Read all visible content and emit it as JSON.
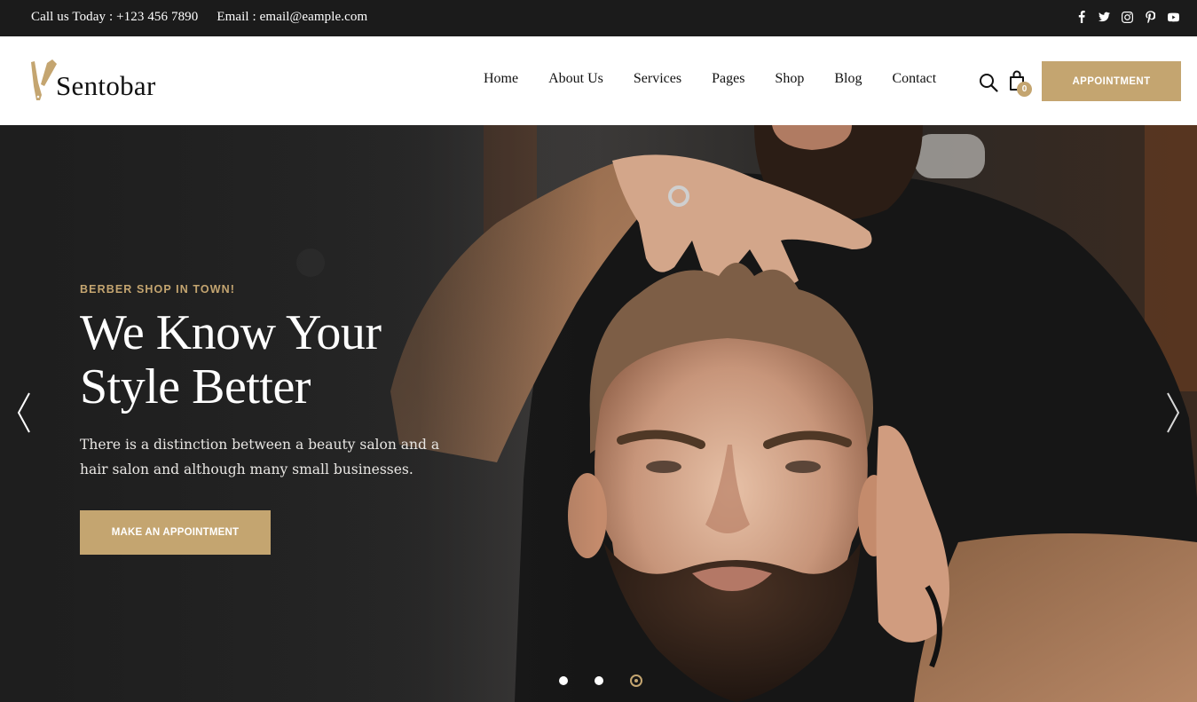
{
  "topbar": {
    "phone": "Call us Today : +123 456 7890",
    "email": "Email : email@eample.com",
    "social": [
      {
        "icon": "facebook-icon"
      },
      {
        "icon": "twitter-icon"
      },
      {
        "icon": "instagram-icon"
      },
      {
        "icon": "pinterest-icon"
      },
      {
        "icon": "youtube-icon"
      }
    ]
  },
  "header": {
    "brand": "Sentobar",
    "nav": [
      "Home",
      "About Us",
      "Services",
      "Pages",
      "Shop",
      "Blog",
      "Contact"
    ],
    "cart_count": "0",
    "appointment_label": "APPOINTMENT"
  },
  "hero": {
    "kicker": "BERBER SHOP IN TOWN!",
    "title_line1": "We Know Your",
    "title_line2": "Style Better",
    "text": "There is a distinction between a beauty salon and a hair salon and although many small businesses.",
    "cta_label": "MAKE AN APPOINTMENT",
    "slides_total": 3,
    "active_slide": 3
  },
  "colors": {
    "accent": "#c4a570",
    "topbar_bg": "#1b1b1b",
    "header_bg": "#ffffff"
  }
}
